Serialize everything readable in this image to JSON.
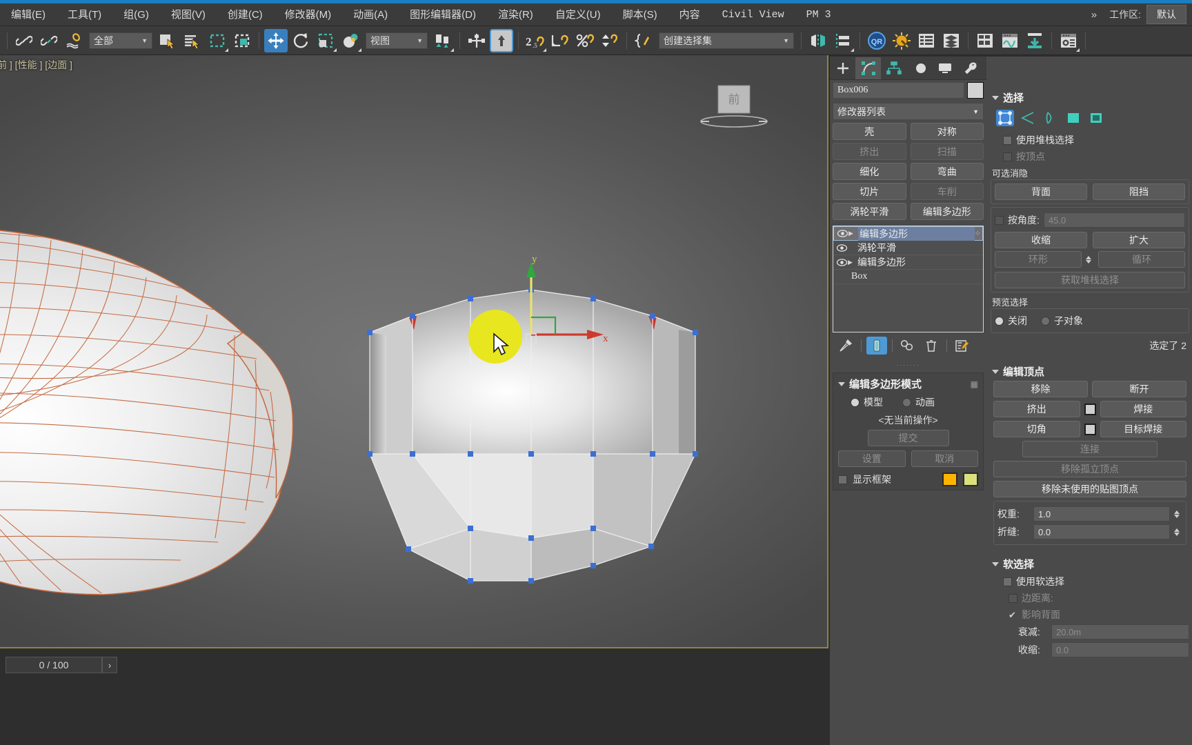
{
  "app": {
    "workspace_label": "工作区:",
    "workspace_value": "默认",
    "overflow_chevron": "»"
  },
  "menubar": {
    "items": [
      {
        "label": "编辑(E)"
      },
      {
        "label": "工具(T)"
      },
      {
        "label": "组(G)"
      },
      {
        "label": "视图(V)"
      },
      {
        "label": "创建(C)"
      },
      {
        "label": "修改器(M)"
      },
      {
        "label": "动画(A)"
      },
      {
        "label": "图形编辑器(D)"
      },
      {
        "label": "渲染(R)"
      },
      {
        "label": "自定义(U)"
      },
      {
        "label": "脚本(S)"
      },
      {
        "label": "内容"
      },
      {
        "label": "Civil View"
      },
      {
        "label": "PM 3"
      }
    ]
  },
  "toolbar": {
    "selection_filter_value": "全部",
    "ref_coord_value": "视图",
    "named_set_value": "创建选择集",
    "icons": [
      "select-link-icon",
      "unlink-icon",
      "bind-space-warp-icon",
      "select-object-icon",
      "select-by-name-icon",
      "rect-select-region-icon",
      "window-crossing-icon",
      "select-move-icon",
      "select-rotate-icon",
      "select-scale-icon",
      "use-pivot-center-icon",
      "mirror-icon",
      "align-icon",
      "snap-toggle-25-icon",
      "angle-snap-icon",
      "percent-snap-icon",
      "spinner-snap-icon",
      "named-selection-sets-icon",
      "mirror-panel-icon",
      "align-panel-icon",
      "quick-render-icon",
      "render-setup-icon",
      "scene-explorer-icon",
      "layer-explorer-icon",
      "curve-editor-icon",
      "schematic-view-icon",
      "content-browser-icon",
      "material-editor-icon"
    ]
  },
  "viewport": {
    "label": "前 ] [性能 ] [边面 ]",
    "viewcube_face": "前",
    "gizmo_axis_x": "x",
    "gizmo_axis_y": "y"
  },
  "statusbar": {
    "time_value": "0 / 100",
    "next_frame": "›"
  },
  "command_panel": {
    "tabs": [
      {
        "name": "create-tab",
        "icon": "plus-icon",
        "selected": false
      },
      {
        "name": "modify-tab",
        "icon": "modify-icon",
        "selected": true
      },
      {
        "name": "hierarchy-tab",
        "icon": "hierarchy-icon",
        "selected": false
      },
      {
        "name": "motion-tab",
        "icon": "motion-icon",
        "selected": false
      },
      {
        "name": "display-tab",
        "icon": "display-icon",
        "selected": false
      },
      {
        "name": "utilities-tab",
        "icon": "wrench-icon",
        "selected": false
      }
    ],
    "object_name": "Box006",
    "modifier_list_label": "修改器列表",
    "modifier_buttons": [
      {
        "label": "壳",
        "disabled": false
      },
      {
        "label": "对称",
        "disabled": false
      },
      {
        "label": "挤出",
        "disabled": true
      },
      {
        "label": "扫描",
        "disabled": true
      },
      {
        "label": "细化",
        "disabled": false
      },
      {
        "label": "弯曲",
        "disabled": false
      },
      {
        "label": "切片",
        "disabled": false
      },
      {
        "label": "车削",
        "disabled": true
      },
      {
        "label": "涡轮平滑",
        "disabled": false
      },
      {
        "label": "编辑多边形",
        "disabled": false
      }
    ],
    "stack": [
      {
        "label": "编辑多边形",
        "eye": true,
        "expandable": true,
        "selected": true
      },
      {
        "label": "涡轮平滑",
        "eye": true,
        "expandable": false,
        "selected": false
      },
      {
        "label": "编辑多边形",
        "eye": true,
        "expandable": true,
        "selected": false
      },
      {
        "label": "Box",
        "eye": false,
        "expandable": false,
        "selected": false,
        "child": true
      }
    ],
    "stack_tools": [
      "pin-stack-icon",
      "show-end-result-icon",
      "make-unique-icon",
      "remove-modifier-icon",
      "configure-modifier-sets-icon"
    ]
  },
  "edit_poly_mode": {
    "title": "编辑多边形模式",
    "model_label": "模型",
    "animate_label": "动画",
    "current_operation": "<无当前操作>",
    "commit_label": "提交",
    "settings_label": "设置",
    "cancel_label": "取消",
    "show_cage_label": "显示框架",
    "cage_color_1": "#ffb400",
    "cage_color_2": "#dbe07d"
  },
  "selection_rollout": {
    "title": "选择",
    "sub_object_modes": [
      "vertex-icon",
      "edge-icon",
      "border-icon",
      "polygon-icon",
      "element-icon"
    ],
    "use_stack_selection": "使用堆栈选择",
    "by_vertex": "按顶点",
    "optional_cull_label": "可选消隐",
    "backface_label": "背面",
    "occluded_label": "阻挡",
    "by_angle_label": "按角度:",
    "by_angle_value": "45.0",
    "shrink_label": "收缩",
    "grow_label": "扩大",
    "ring_label": "环形",
    "loop_label": "循环",
    "get_stack_selection": "获取堆栈选择",
    "preview_selection_label": "预览选择",
    "preview_off": "关闭",
    "preview_subobj": "子对象",
    "selected_info": "选定了 2"
  },
  "edit_vertices": {
    "title": "编辑顶点",
    "remove_label": "移除",
    "break_label": "断开",
    "extrude_label": "挤出",
    "weld_label": "焊接",
    "chamfer_label": "切角",
    "target_weld_label": "目标焊接",
    "connect_label": "连接",
    "remove_isolated_label": "移除孤立顶点",
    "remove_unused_label": "移除未使用的贴图顶点",
    "weight_label": "权重:",
    "weight_value": "1.0",
    "crease_label": "折缝:",
    "crease_value": "0.0"
  },
  "soft_selection": {
    "title": "软选择",
    "use_soft_selection": "使用软选择",
    "edge_distance": "边距离:",
    "affect_backfacing": "影响背面",
    "falloff_label": "衰减:",
    "falloff_value": "20.0m",
    "pinch_label": "收缩:",
    "pinch_value": "0.0"
  },
  "colors": {
    "accent_blue": "#1a7fc1",
    "active_button": "#3a7fbd",
    "viewport_border": "#8d8547",
    "panel_bg": "#4a4a4a",
    "highlight_yellow": "#e8e61e"
  }
}
